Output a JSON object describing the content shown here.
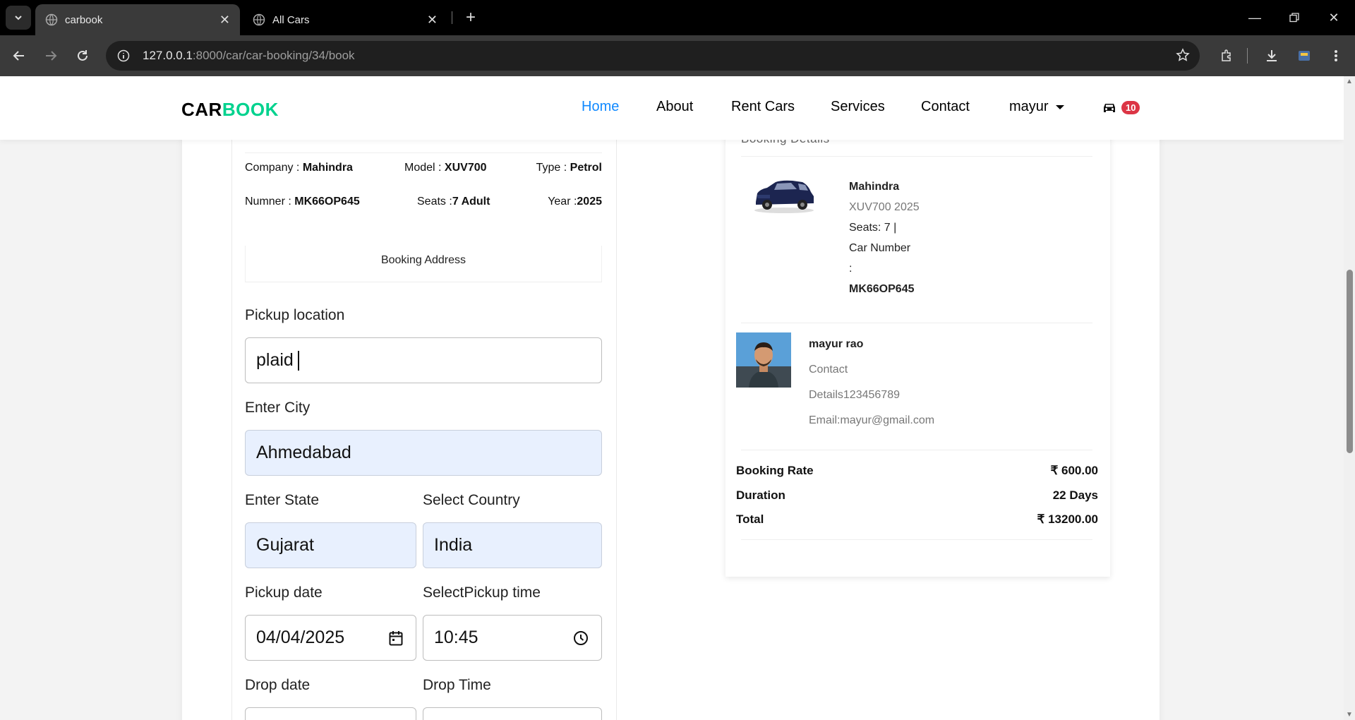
{
  "browser": {
    "tabs": [
      {
        "title": "carbook",
        "active": true
      },
      {
        "title": "All Cars",
        "active": false
      }
    ],
    "url": {
      "host": "127.0.0.1",
      "path": ":8000/car/car-booking/34/book"
    }
  },
  "nav": {
    "brand_part1": "CAR",
    "brand_part2": "BOOK",
    "links": [
      "Home",
      "About",
      "Rent Cars",
      "Services",
      "Contact"
    ],
    "user": "mayur",
    "cart_count": "10",
    "colors": {
      "active": "#1089ff",
      "brand": "#01d28e",
      "badge": "#dc3545"
    }
  },
  "car_specs": {
    "company_label": "Company :",
    "company": "Mahindra",
    "model_label": "Model :",
    "model": "XUV700",
    "type_label": "Type :",
    "type": "Petrol",
    "number_label": "Numner :",
    "number": "MK66OP645",
    "seats_label": "Seats :",
    "seats": "7 Adult",
    "year_label": "Year :",
    "year": "2025"
  },
  "booking_form": {
    "section_title": "Booking Address",
    "pickup_label": "Pickup location",
    "pickup_value": "plaid",
    "city_label": "Enter City",
    "city_value": "Ahmedabad",
    "state_label": "Enter State",
    "state_value": "Gujarat",
    "country_label": "Select Country",
    "country_value": "India",
    "pickup_date_label": "Pickup date",
    "pickup_date_value": "04/04/2025",
    "pickup_time_label": "SelectPickup time",
    "pickup_time_value": "10:45",
    "drop_date_label": "Drop date",
    "drop_time_label": "Drop Time"
  },
  "details": {
    "heading": "Booking Details",
    "car_brand": "Mahindra",
    "car_model_year": "XUV700 2025",
    "seats_line": "Seats: 7 |",
    "car_number_label": "Car Number",
    "colon": ":",
    "car_number": "MK66OP645",
    "user_name": "mayur rao",
    "contact_label": "Contact",
    "contact_details": "Details123456789",
    "email": "Email:mayur@gmail.com",
    "rate_label": "Booking Rate",
    "rate_value": "₹ 600.00",
    "duration_label": "Duration",
    "duration_value": "22 Days",
    "total_label": "Total",
    "total_value": "₹ 13200.00"
  }
}
